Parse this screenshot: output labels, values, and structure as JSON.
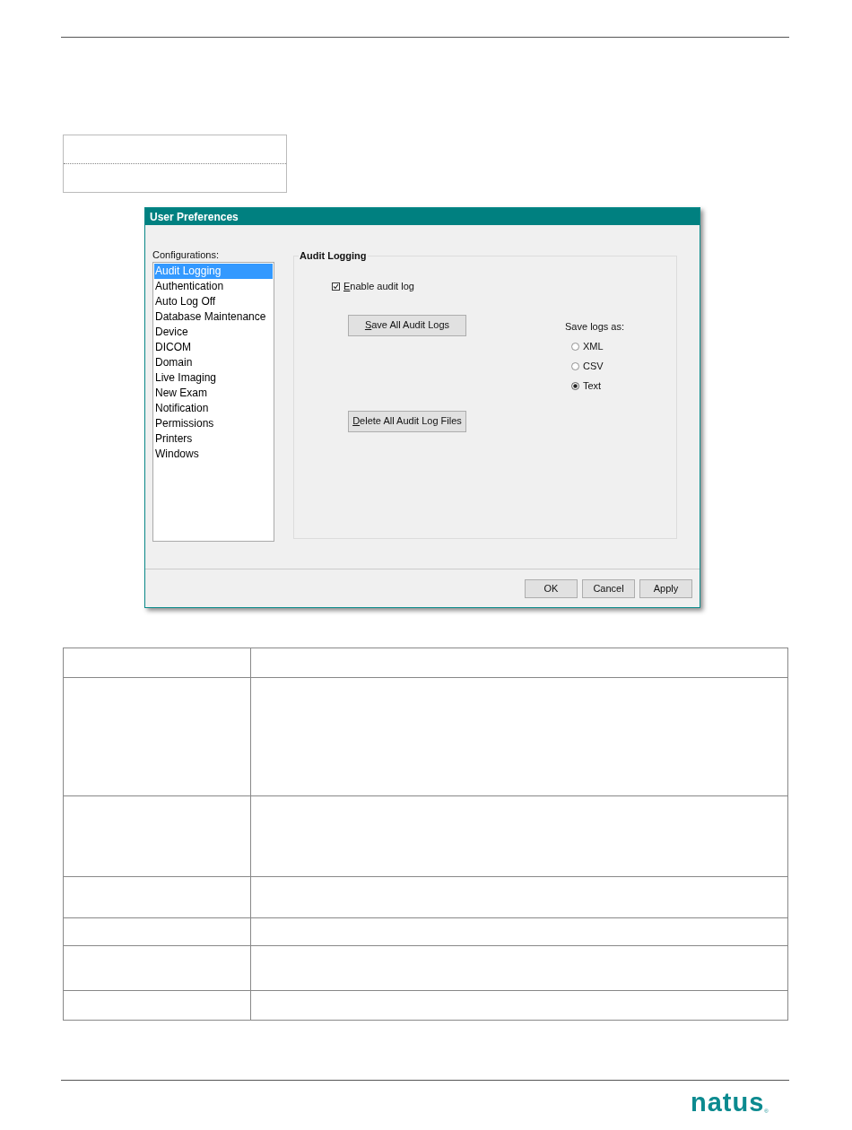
{
  "dialog": {
    "title": "User Preferences",
    "list_label": "Configurations:",
    "config_items": [
      {
        "label": "Audit Logging",
        "selected": true
      },
      {
        "label": "Authentication",
        "selected": false
      },
      {
        "label": "Auto Log Off",
        "selected": false
      },
      {
        "label": "Database Maintenance",
        "selected": false
      },
      {
        "label": "Device",
        "selected": false
      },
      {
        "label": "DICOM",
        "selected": false
      },
      {
        "label": "Domain",
        "selected": false
      },
      {
        "label": "Live Imaging",
        "selected": false
      },
      {
        "label": "New Exam",
        "selected": false
      },
      {
        "label": "Notification",
        "selected": false
      },
      {
        "label": "Permissions",
        "selected": false
      },
      {
        "label": "Printers",
        "selected": false
      },
      {
        "label": "Windows",
        "selected": false
      }
    ],
    "group_title": "Audit Logging",
    "enable_checkbox": {
      "label": "Enable audit log",
      "checked": true
    },
    "save_button": "Save All Audit Logs",
    "save_as_label": "Save logs as:",
    "formats": [
      {
        "label": "XML",
        "selected": false
      },
      {
        "label": "CSV",
        "selected": false
      },
      {
        "label": "Text",
        "selected": true
      }
    ],
    "delete_button": "Delete All Audit Log Files",
    "footer_buttons": [
      "OK",
      "Cancel",
      "Apply"
    ]
  },
  "logo": {
    "text": "natus",
    "mark": "®"
  }
}
